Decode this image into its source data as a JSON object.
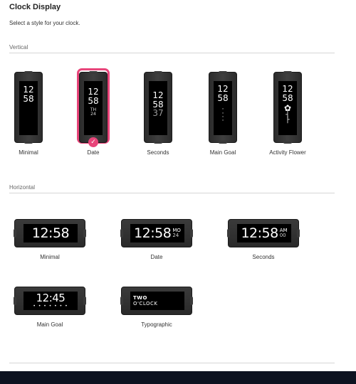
{
  "header": {
    "title": "Clock Display",
    "subtitle": "Select a style for your clock."
  },
  "vertical": {
    "label": "Vertical",
    "selected": "Date",
    "options": [
      {
        "name": "Minimal",
        "lines": [
          "12",
          "58"
        ]
      },
      {
        "name": "Date",
        "lines": [
          "12",
          "58"
        ],
        "extra": [
          "TH",
          "24"
        ]
      },
      {
        "name": "Seconds",
        "lines": [
          "12",
          "58"
        ],
        "seconds": "37"
      },
      {
        "name": "Main Goal",
        "lines": [
          "12",
          "58"
        ]
      },
      {
        "name": "Activity Flower",
        "lines": [
          "12",
          "58"
        ]
      }
    ]
  },
  "horizontal": {
    "label": "Horizontal",
    "options": [
      {
        "name": "Minimal",
        "time": "12:58"
      },
      {
        "name": "Date",
        "time": "12:58",
        "side_top": "MO",
        "side_bottom": "24"
      },
      {
        "name": "Seconds",
        "time": "12:58",
        "side_top": "AM",
        "side_bottom": "00"
      },
      {
        "name": "Main Goal",
        "time": "12:45"
      },
      {
        "name": "Typographic",
        "line1": "TWO",
        "line2": "O'CLOCK"
      }
    ]
  },
  "colors": {
    "accent": "#e8457a",
    "device": "#2f2f2f",
    "screen": "#000000",
    "footer": "#0d1220"
  },
  "icons": {
    "selected": "check-icon",
    "flower": "flower-icon"
  }
}
